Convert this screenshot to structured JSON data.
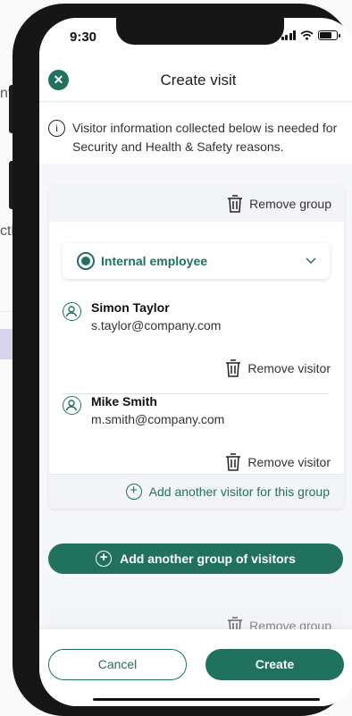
{
  "background": {
    "fragments": [
      "nf",
      "ctly"
    ]
  },
  "status_bar": {
    "time": "9:30"
  },
  "header": {
    "title": "Create visit",
    "close_icon": "close-icon"
  },
  "info": {
    "text": "Visitor information collected below is needed for Security and Health & Safety reasons."
  },
  "group": {
    "remove_label": "Remove group",
    "visitor_type": "Internal employee",
    "visitors": [
      {
        "name": "Simon Taylor",
        "email": "s.taylor@company.com",
        "remove_label": "Remove visitor"
      },
      {
        "name": "Mike Smith",
        "email": "m.smith@company.com",
        "remove_label": "Remove visitor"
      }
    ],
    "add_visitor_label": "Add another visitor for this group"
  },
  "add_group_label": "Add another group of visitors",
  "next_group": {
    "remove_label": "Remove group"
  },
  "footer": {
    "cancel_label": "Cancel",
    "create_label": "Create"
  },
  "colors": {
    "accent": "#20725f",
    "background": "#f6f7fa"
  }
}
